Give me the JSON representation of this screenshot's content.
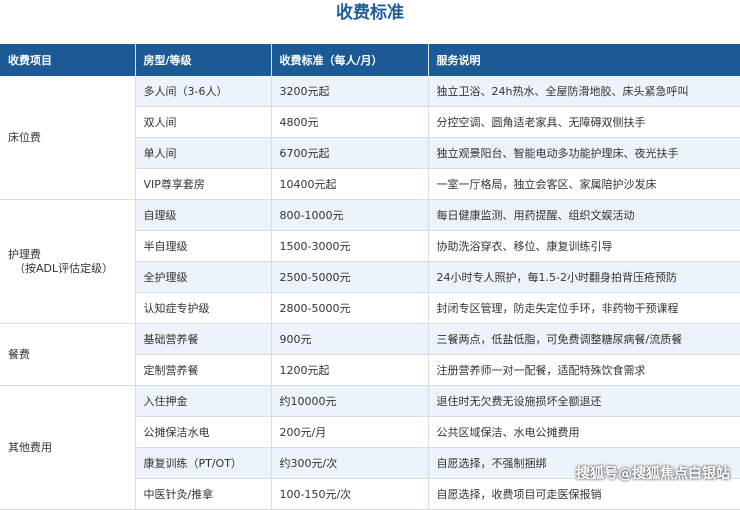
{
  "title": "收费标准",
  "columns": [
    "收费项目",
    "房型/等级",
    "收费标准（每人/月）",
    "服务说明"
  ],
  "groups": [
    {
      "category": "床位费",
      "category_sub": "",
      "rows": [
        {
          "level": "多人间（3-6人）",
          "price": "3200元起",
          "desc": "独立卫浴、24h热水、全屋防滑地胶、床头紧急呼叫"
        },
        {
          "level": "双人间",
          "price": "4800元",
          "desc": "分控空调、圆角适老家具、无障碍双侧扶手"
        },
        {
          "level": "单人间",
          "price": "6700元起",
          "desc": "独立观景阳台、智能电动多功能护理床、夜光扶手"
        },
        {
          "level": "VIP尊享套房",
          "price": "10400元起",
          "desc": "一室一厅格局，独立会客区、家属陪护沙发床"
        }
      ]
    },
    {
      "category": "护理费",
      "category_sub": "（按ADL评估定级）",
      "rows": [
        {
          "level": "自理级",
          "price": "800-1000元",
          "desc": "每日健康监测、用药提醒、组织文娱活动"
        },
        {
          "level": "半自理级",
          "price": "1500-3000元",
          "desc": "协助洗浴穿衣、移位、康复训练引导"
        },
        {
          "level": "全护理级",
          "price": "2500-5000元",
          "desc": "24小时专人照护，每1.5-2小时翻身拍背压疮预防"
        },
        {
          "level": "认知症专护级",
          "price": "2800-5000元",
          "desc": "封闭专区管理，防走失定位手环，非药物干预课程"
        }
      ]
    },
    {
      "category": "餐费",
      "category_sub": "",
      "rows": [
        {
          "level": "基础营养餐",
          "price": "900元",
          "desc": "三餐两点，低盐低脂，可免费调整糖尿病餐/流质餐"
        },
        {
          "level": "定制营养餐",
          "price": "1200元起",
          "desc": "注册营养师一对一配餐，适配特殊饮食需求"
        }
      ]
    },
    {
      "category": "其他费用",
      "category_sub": "",
      "rows": [
        {
          "level": "入住押金",
          "price": "约10000元",
          "desc": "退住时无欠费无设施损坏全额退还"
        },
        {
          "level": "公摊保洁水电",
          "price": "200元/月",
          "desc": "公共区域保洁、水电公摊费用"
        },
        {
          "level": "康复训练（PT/OT）",
          "price": "约300元/次",
          "desc": "自愿选择，不强制捆绑"
        },
        {
          "level": "中医针灸/推拿",
          "price": "100-150元/次",
          "desc": "自愿选择，收费项目可走医保报销"
        }
      ]
    }
  ],
  "watermark": "搜狐号@搜狐焦点白银站"
}
